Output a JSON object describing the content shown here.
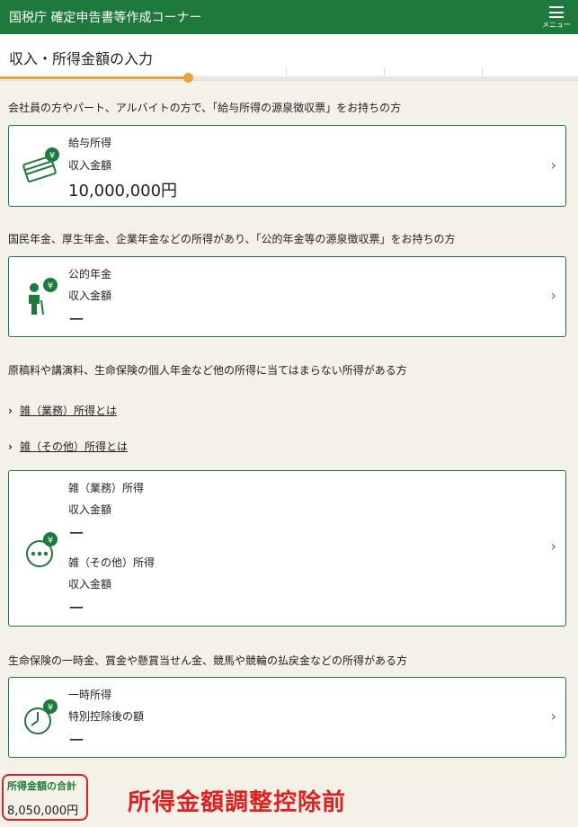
{
  "header": {
    "title": "国税庁 確定申告書等作成コーナー",
    "menu_label": "メニュー"
  },
  "page": {
    "title": "収入・所得金額の入力"
  },
  "sections": {
    "salary": {
      "description": "会社員の方やパート、アルバイトの方で、「給与所得の源泉徴収票」をお持ちの方",
      "card": {
        "icon": "salary-card-icon",
        "name": "給与所得",
        "amount_label": "収入金額",
        "amount": "10,000,000円"
      }
    },
    "pension": {
      "description": "国民年金、厚生年金、企業年金などの所得があり、「公的年金等の源泉徴収票」をお持ちの方",
      "card": {
        "icon": "elderly-person-icon",
        "name": "公的年金",
        "amount_label": "収入金額",
        "amount": "ー"
      }
    },
    "misc": {
      "description": "原稿料や講演料、生命保険の個人年金など他の所得に当てはまらない所得がある方",
      "links": [
        "雑（業務）所得とは",
        "雑（その他）所得とは"
      ],
      "card": {
        "icon": "more-dots-icon",
        "business": {
          "name": "雑（業務）所得",
          "amount_label": "収入金額",
          "amount": "ー"
        },
        "other": {
          "name": "雑（その他）所得",
          "amount_label": "収入金額",
          "amount": "ー"
        }
      }
    },
    "temporary": {
      "description": "生命保険の一時金、賞金や懸賞当せん金、競馬や競輪の払戻金などの所得がある方",
      "card": {
        "icon": "clock-icon",
        "name": "一時所得",
        "amount_label": "特別控除後の額",
        "amount": "ー"
      }
    }
  },
  "total": {
    "label": "所得金額の合計",
    "value": "8,050,000円"
  },
  "annotation": "所得金額調整控除前",
  "colors": {
    "brand_green": "#1e7a3c",
    "progress_orange": "#e8a43a",
    "annotation_red": "#e02020"
  }
}
